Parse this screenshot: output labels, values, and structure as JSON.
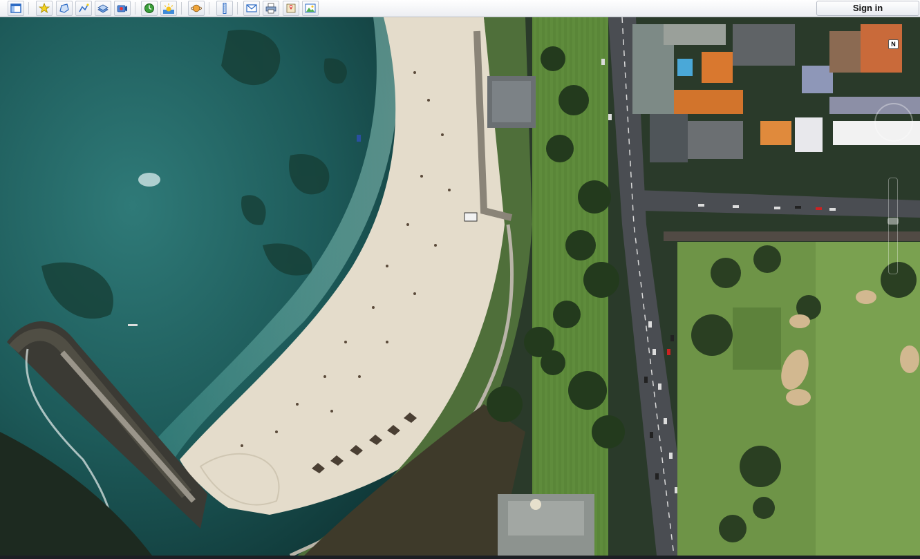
{
  "toolbar": {
    "buttons": [
      {
        "name": "sidebar-toggle",
        "icon": "sidebar-icon"
      },
      {
        "name": "add-placemark",
        "icon": "placemark-star-icon"
      },
      {
        "name": "add-polygon",
        "icon": "polygon-icon"
      },
      {
        "name": "add-path",
        "icon": "path-icon"
      },
      {
        "name": "add-image-overlay",
        "icon": "image-overlay-icon"
      },
      {
        "name": "record-tour",
        "icon": "record-tour-icon"
      },
      {
        "name": "historical-imagery",
        "icon": "clock-icon"
      },
      {
        "name": "sunlight",
        "icon": "sun-icon"
      },
      {
        "name": "switch-planet",
        "icon": "planet-icon"
      },
      {
        "name": "ruler",
        "icon": "ruler-icon"
      },
      {
        "name": "email",
        "icon": "email-icon"
      },
      {
        "name": "print",
        "icon": "print-icon"
      },
      {
        "name": "view-in-maps",
        "icon": "maps-icon"
      },
      {
        "name": "save-image",
        "icon": "save-image-icon"
      }
    ],
    "signin_label": "Sign in"
  },
  "nav": {
    "compass_label": "N"
  },
  "colors": {
    "ocean_deep": "#12403f",
    "ocean_shallow": "#2f7a78",
    "sand": "#e4dccb",
    "grass": "#5e8b3e",
    "road": "#4a4d52",
    "accent": "#3b6fd6"
  }
}
